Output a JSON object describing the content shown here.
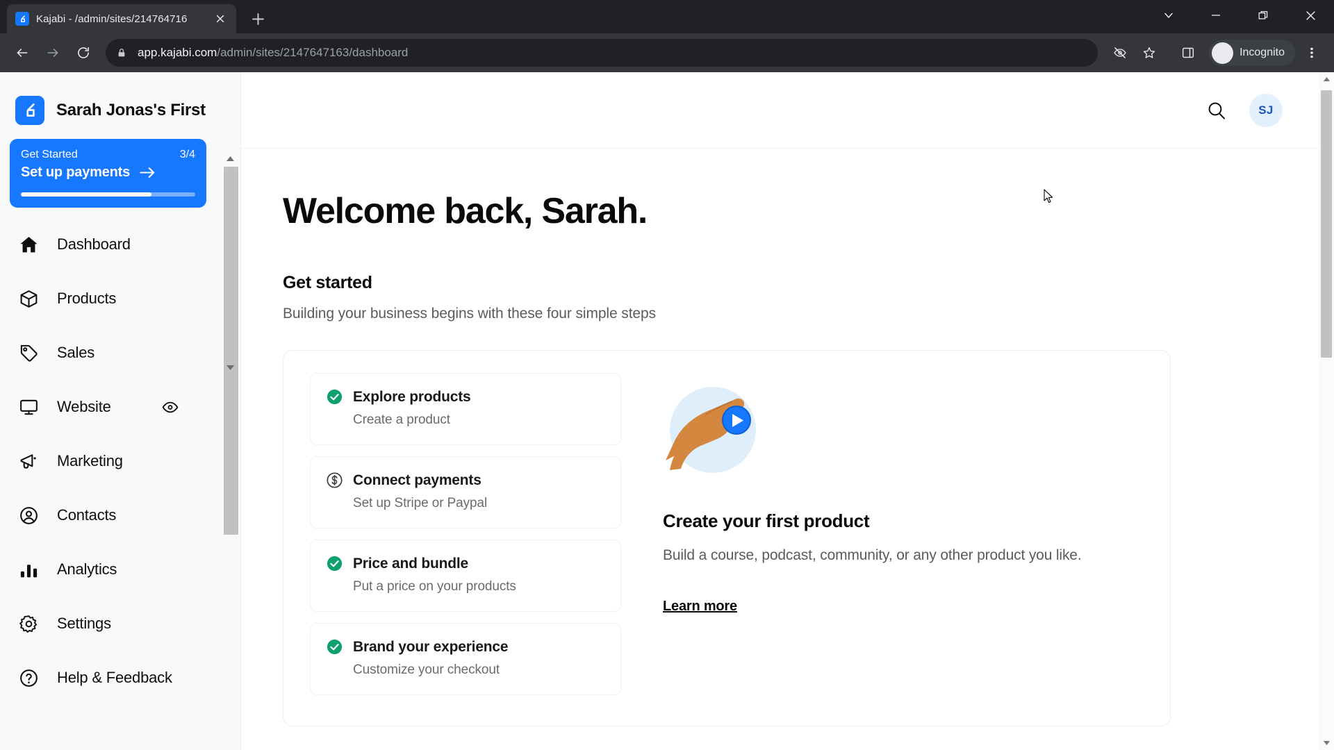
{
  "browser": {
    "tab": {
      "title": "Kajabi - /admin/sites/214764716",
      "favicon": "kajabi-logo-icon",
      "close_icon": "close-icon"
    },
    "new_tab_icon": "plus-icon",
    "window_controls": [
      {
        "name": "tab-search-button",
        "icon": "chevron-down-icon"
      },
      {
        "name": "minimize-button",
        "icon": "minimize-icon"
      },
      {
        "name": "restore-button",
        "icon": "restore-icon"
      },
      {
        "name": "close-window-button",
        "icon": "close-icon"
      }
    ],
    "toolbar": {
      "back_icon": "arrow-left-icon",
      "forward_icon": "arrow-right-icon",
      "reload_icon": "reload-icon",
      "lock_icon": "lock-icon",
      "url_host": "app.kajabi.com",
      "url_path": "/admin/sites/2147647163/dashboard",
      "third_party_cookie_icon": "eye-slash-icon",
      "bookmark_icon": "star-icon",
      "side_panel_icon": "side-panel-icon",
      "incognito_icon": "incognito-icon",
      "incognito_label": "Incognito",
      "menu_icon": "three-dots-vertical-icon"
    }
  },
  "sidebar": {
    "brand": {
      "logo_icon": "kajabi-logo-icon",
      "name": "Sarah Jonas's First"
    },
    "get_started_card": {
      "label": "Get Started",
      "count": "3/4",
      "action": "Set up payments",
      "arrow_icon": "arrow-right-icon",
      "progress_percent": 75,
      "accent_color": "#1677ff"
    },
    "items": [
      {
        "label": "Dashboard",
        "icon": "home-icon",
        "trailing": null
      },
      {
        "label": "Products",
        "icon": "cube-icon",
        "trailing": null
      },
      {
        "label": "Sales",
        "icon": "tag-icon",
        "trailing": null
      },
      {
        "label": "Website",
        "icon": "monitor-icon",
        "trailing": "eye-icon"
      },
      {
        "label": "Marketing",
        "icon": "megaphone-icon",
        "trailing": null
      },
      {
        "label": "Contacts",
        "icon": "person-circle-icon",
        "trailing": null
      },
      {
        "label": "Analytics",
        "icon": "bar-chart-icon",
        "trailing": null
      },
      {
        "label": "Settings",
        "icon": "gear-icon",
        "trailing": null
      },
      {
        "label": "Help & Feedback",
        "icon": "question-circle-icon",
        "trailing": null
      }
    ],
    "scrollbar": {
      "up_icon": "caret-up-icon",
      "down_icon": "caret-down-icon"
    }
  },
  "header": {
    "search_icon": "search-icon",
    "avatar_initials": "SJ",
    "avatar_bg": "#e3f0fd",
    "avatar_color": "#1a56c4"
  },
  "main": {
    "welcome_heading": "Welcome back, Sarah.",
    "section_title": "Get started",
    "section_subtitle": "Building your business begins with these four simple steps",
    "steps": [
      {
        "title": "Explore products",
        "subtitle": "Create a product",
        "state": "complete",
        "icon": "check-circle-icon"
      },
      {
        "title": "Connect payments",
        "subtitle": "Set up Stripe or Paypal",
        "state": "incomplete",
        "icon": "dollar-circle-icon"
      },
      {
        "title": "Price and bundle",
        "subtitle": "Put a price on your products",
        "state": "complete",
        "icon": "check-circle-icon"
      },
      {
        "title": "Brand your experience",
        "subtitle": "Customize your checkout",
        "state": "complete",
        "icon": "check-circle-icon"
      }
    ],
    "promo": {
      "illustration": "hand-holding-play-button-icon",
      "title": "Create your first product",
      "text": "Build a course, podcast, community, or any other product you like.",
      "link": "Learn more"
    },
    "colors": {
      "complete": "#0e9f6e",
      "incomplete": "#3b3b3b",
      "accent": "#1677ff"
    },
    "scrollbar": {
      "up_icon": "caret-up-icon",
      "down_icon": "caret-down-icon"
    }
  }
}
